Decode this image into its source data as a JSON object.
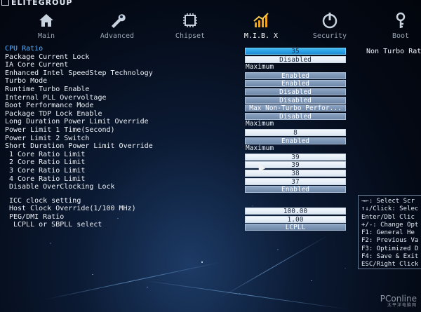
{
  "brand": "ELITEGROUP",
  "tabs": [
    {
      "label": "Main",
      "icon": "home-icon"
    },
    {
      "label": "Advanced",
      "icon": "wrench-icon"
    },
    {
      "label": "Chipset",
      "icon": "chip-icon"
    },
    {
      "label": "M.I.B. X",
      "icon": "chart-icon",
      "active": true
    },
    {
      "label": "Security",
      "icon": "power-icon"
    },
    {
      "label": "Boot",
      "icon": "key-icon"
    }
  ],
  "settings": [
    {
      "label": "CPU Ratio",
      "value": "35",
      "style": "sel",
      "kind": "hdr"
    },
    {
      "label": "Package Current Lock",
      "value": "Disabled",
      "style": "light"
    },
    {
      "label": "IA Core Current",
      "value": "Maximum",
      "style": "plain"
    },
    {
      "label": "Enhanced Intel SpeedStep Technology",
      "value": "Enabled",
      "style": "box"
    },
    {
      "label": "Turbo Mode",
      "value": "Enabled",
      "style": "box"
    },
    {
      "label": "Runtime Turbo Enable",
      "value": "Disabled",
      "style": "box"
    },
    {
      "label": "Internal PLL Overvoltage",
      "value": "Disabled",
      "style": "box"
    },
    {
      "label": "Boot Performance Mode",
      "value": "Max Non-Turbo Perfor...",
      "style": "box"
    },
    {
      "label": "Package TDP Lock Enable",
      "value": "Disabled",
      "style": "box"
    },
    {
      "label": "Long Duration Power Limit Override",
      "value": "Maximum",
      "style": "plain"
    },
    {
      "label": "Power Limit 1 Time(Second)",
      "value": "8",
      "style": "light"
    },
    {
      "label": "Power Limit 2 Switch",
      "value": "Enabled",
      "style": "box"
    },
    {
      "label": "Short Duration Power Limit Override",
      "value": "Maximum",
      "style": "plain"
    },
    {
      "label": "1 Core Ratio Limit",
      "value": "39",
      "style": "light",
      "kind": "sub"
    },
    {
      "label": "2 Core Ratio Limit",
      "value": "39",
      "style": "light",
      "kind": "sub"
    },
    {
      "label": "3 Core Ratio Limit",
      "value": "38",
      "style": "light",
      "kind": "sub"
    },
    {
      "label": "4 Core Ratio Limit",
      "value": "37",
      "style": "light",
      "kind": "sub"
    },
    {
      "label": "Disable OverClocking Lock",
      "value": "Enabled",
      "style": "box",
      "kind": "sub"
    }
  ],
  "icc": [
    {
      "label": "ICC clock setting",
      "value": "",
      "style": "spacer",
      "kind": "sub"
    },
    {
      "label": "Host Clock Override(1/100 MHz)",
      "value": "100.00",
      "style": "light",
      "kind": "sub"
    },
    {
      "label": "PEG/DMI Ratio",
      "value": "1.00",
      "style": "light",
      "kind": "sub"
    },
    {
      "label": "LCPLL or SBPLL select",
      "value": "LCPLL",
      "style": "box",
      "kind": "sub2"
    }
  ],
  "help_text": "Non Turbo Rat",
  "key_help": [
    "→←: Select Scr",
    "↑↓/Click: Selec",
    "Enter/Dbl Clic",
    "+/-: Change Opt",
    "F1: General He",
    "F2: Previous Va",
    "F3: Optimized D",
    "F4: Save & Exit",
    "ESC/Right Click"
  ],
  "watermark": {
    "main": "PConline",
    "sub": "太平洋电脑网"
  },
  "colors": {
    "header": "#5ab4ff",
    "selected": "#1e8ed6",
    "value_box": "#7d95b5"
  }
}
